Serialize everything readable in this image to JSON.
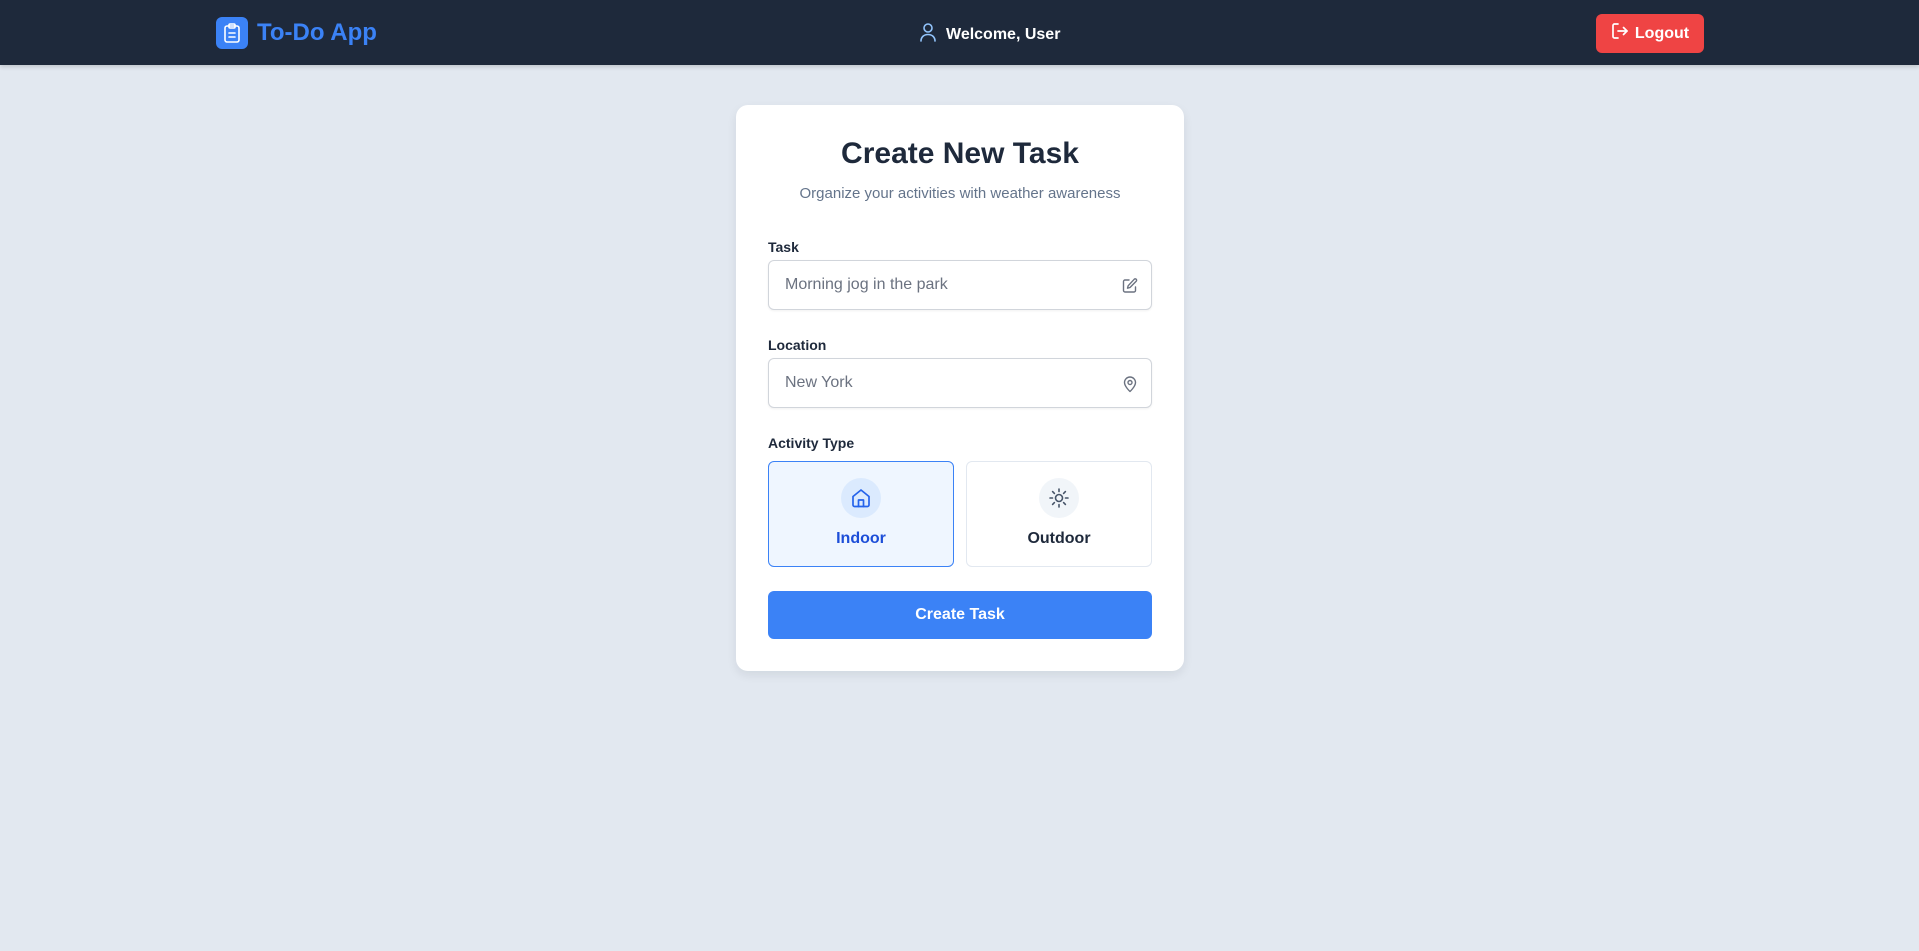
{
  "navbar": {
    "app_title": "To-Do App",
    "welcome_text": "Welcome, User",
    "logout_label": "Logout",
    "brand_color": "#3b82f6",
    "background": "#1e293b",
    "logout_color": "#ef4444"
  },
  "form": {
    "title": "Create New Task",
    "subtitle": "Organize your activities with weather awareness",
    "task": {
      "label": "Task",
      "placeholder": "Morning jog in the park",
      "value": "",
      "icon": "edit-icon"
    },
    "location": {
      "label": "Location",
      "placeholder": "New York",
      "value": "",
      "icon": "map-pin-icon"
    },
    "activity_type": {
      "label": "Activity Type",
      "selected": "Indoor",
      "options": [
        {
          "label": "Indoor",
          "icon": "home-icon"
        },
        {
          "label": "Outdoor",
          "icon": "sun-icon"
        }
      ]
    },
    "submit_label": "Create Task"
  },
  "colors": {
    "page_background": "#e2e8f0",
    "accent": "#3b82f6",
    "selected_option_bg": "#eff6ff",
    "selected_option_text": "#1d4ed8"
  }
}
